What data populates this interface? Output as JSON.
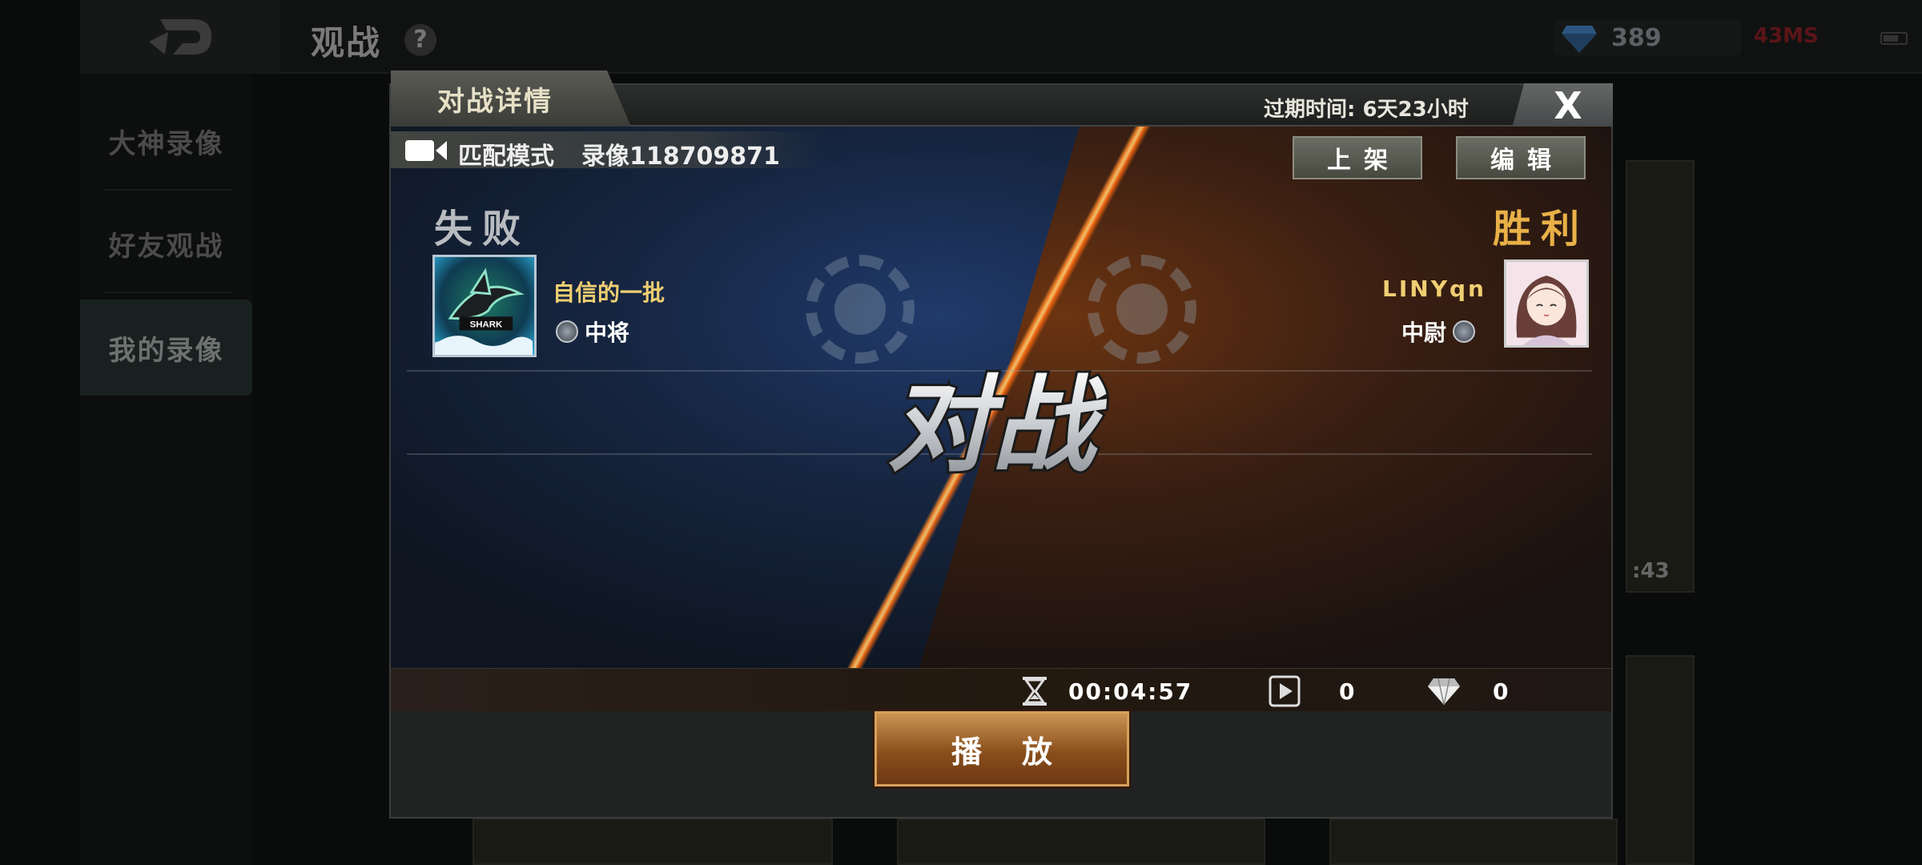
{
  "top_bar": {
    "page_title": "观战",
    "help_glyph": "?",
    "diamonds": "389",
    "ping": "43MS"
  },
  "sidebar": {
    "items": [
      {
        "label": "大神录像"
      },
      {
        "label": "好友观战"
      },
      {
        "label": "我的录像"
      }
    ],
    "active": "我的录像"
  },
  "background_fragment": ":43",
  "modal": {
    "title": "对战详情",
    "expire_text": "过期时间: 6天23小时",
    "close_glyph": "X",
    "mode_label": "匹配模式",
    "record_label": "录像118709871",
    "list_button": "上架",
    "edit_button": "编辑",
    "vs_text": "对战",
    "left_player": {
      "result": "失败",
      "name": "自信的一批",
      "rank": "中将",
      "avatar_text": "SHARK"
    },
    "right_player": {
      "result": "胜利",
      "name": "LINYqn",
      "rank": "中尉"
    },
    "stats": {
      "duration": "00:04:57",
      "plays": "0",
      "diamonds": "0"
    },
    "play_button": "播放"
  },
  "colors": {
    "lose_accent": "#b8bcc0",
    "win_accent": "#e8b047",
    "player_name": "#f0cf72",
    "play_button": "#a86a2c"
  },
  "icons": [
    "back-icon",
    "help-icon",
    "diamond-icon",
    "close-icon",
    "video-icon",
    "rank-badge-icon",
    "hourglass-icon",
    "play-count-icon"
  ]
}
